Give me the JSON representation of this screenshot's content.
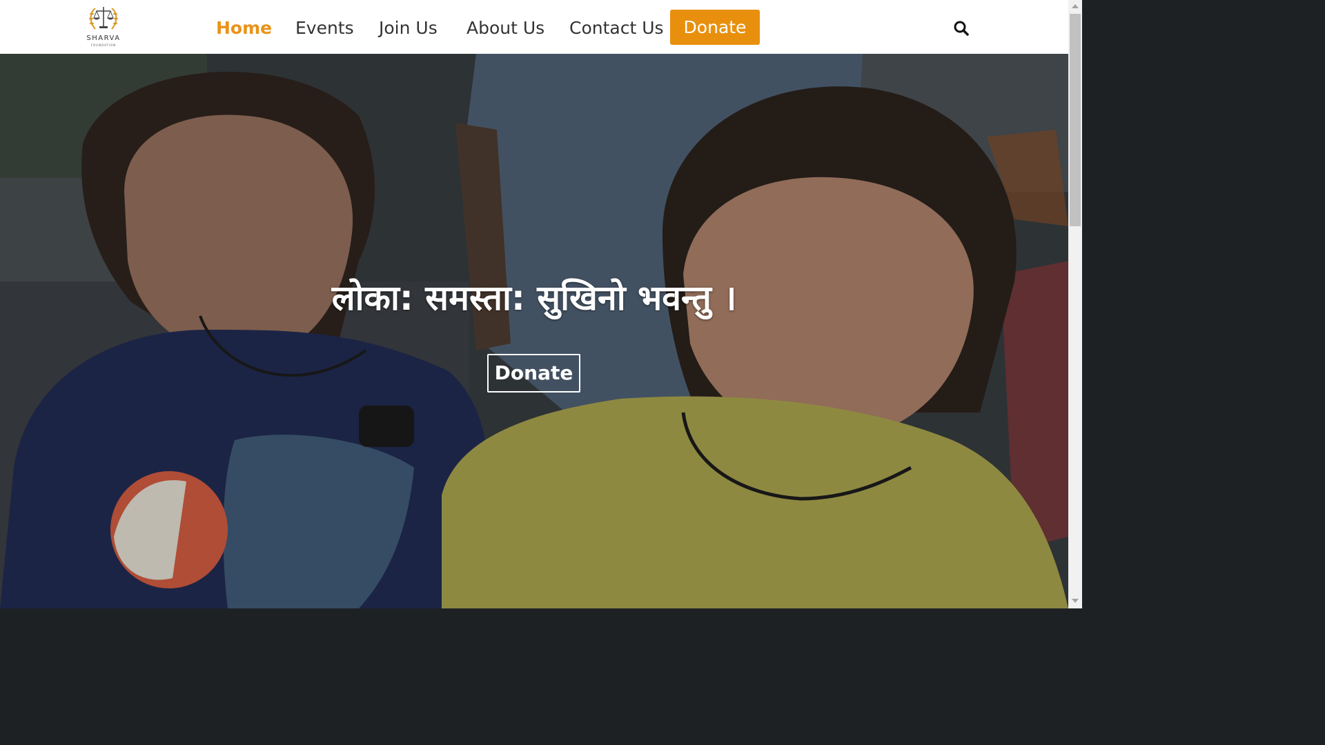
{
  "logo": {
    "name": "SHARVA",
    "subtitle": "FOUNDATION",
    "icon": "scales-of-justice-laurel-icon"
  },
  "nav": {
    "items": [
      {
        "label": "Home",
        "active": true
      },
      {
        "label": "Events",
        "active": false
      },
      {
        "label": "Join Us",
        "active": false
      },
      {
        "label": "About Us",
        "active": false
      },
      {
        "label": "Contact Us",
        "active": false
      }
    ],
    "donate_label": "Donate",
    "search_icon": "search-icon"
  },
  "hero": {
    "title": "लोका: समस्ता: सुखिनो भवन्तु ।",
    "button_label": "Donate",
    "image": "photo of two children in the street"
  },
  "colors": {
    "accent": "#e8900d",
    "active_nav": "#e99319",
    "nav_text": "#333333",
    "hero_text": "#ffffff"
  }
}
